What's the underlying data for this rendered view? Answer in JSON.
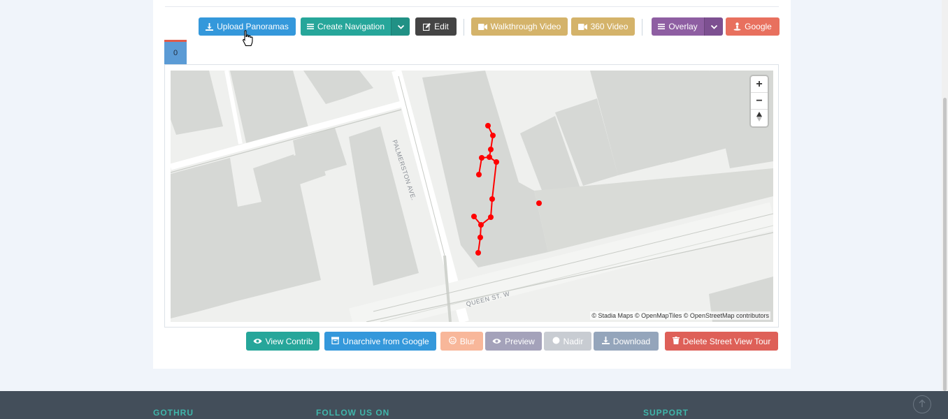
{
  "toolbar": {
    "upload": "Upload Panoramas",
    "create_nav": "Create Navigation",
    "edit": "Edit",
    "walkthrough": "Walkthrough Video",
    "video360": "360 Video",
    "overlay": "Overlay",
    "google": "Google"
  },
  "tab": {
    "label": "0"
  },
  "map": {
    "street_vertical": "PALMERSTON AVE.",
    "street_horizontal": "QUEEN ST. W",
    "attribution": "© Stadia Maps © OpenMapTiles © OpenStreetMap contributors",
    "zoom_in": "+",
    "zoom_out": "−"
  },
  "actions": {
    "view_contrib": "View Contrib",
    "unarchive": "Unarchive from Google",
    "blur": "Blur",
    "preview": "Preview",
    "nadir": "Nadir",
    "download": "Download",
    "delete": "Delete Street View Tour"
  },
  "footer": {
    "col1": "GOTHRU",
    "col2": "FOLLOW US ON",
    "col3": "SUPPORT"
  },
  "colors": {
    "primary": "#3498db",
    "teal": "#26a69a",
    "dark": "#444444",
    "gold": "#d4b36a",
    "purple": "#8e5ea2",
    "red": "#e8705e",
    "route": "#ff0000"
  },
  "icons": [
    "download-icon",
    "list-icon",
    "edit-icon",
    "video-icon",
    "google-icon",
    "eye-icon",
    "archive-icon",
    "smile-icon",
    "circle-icon",
    "trash-icon",
    "arrow-up-icon"
  ]
}
